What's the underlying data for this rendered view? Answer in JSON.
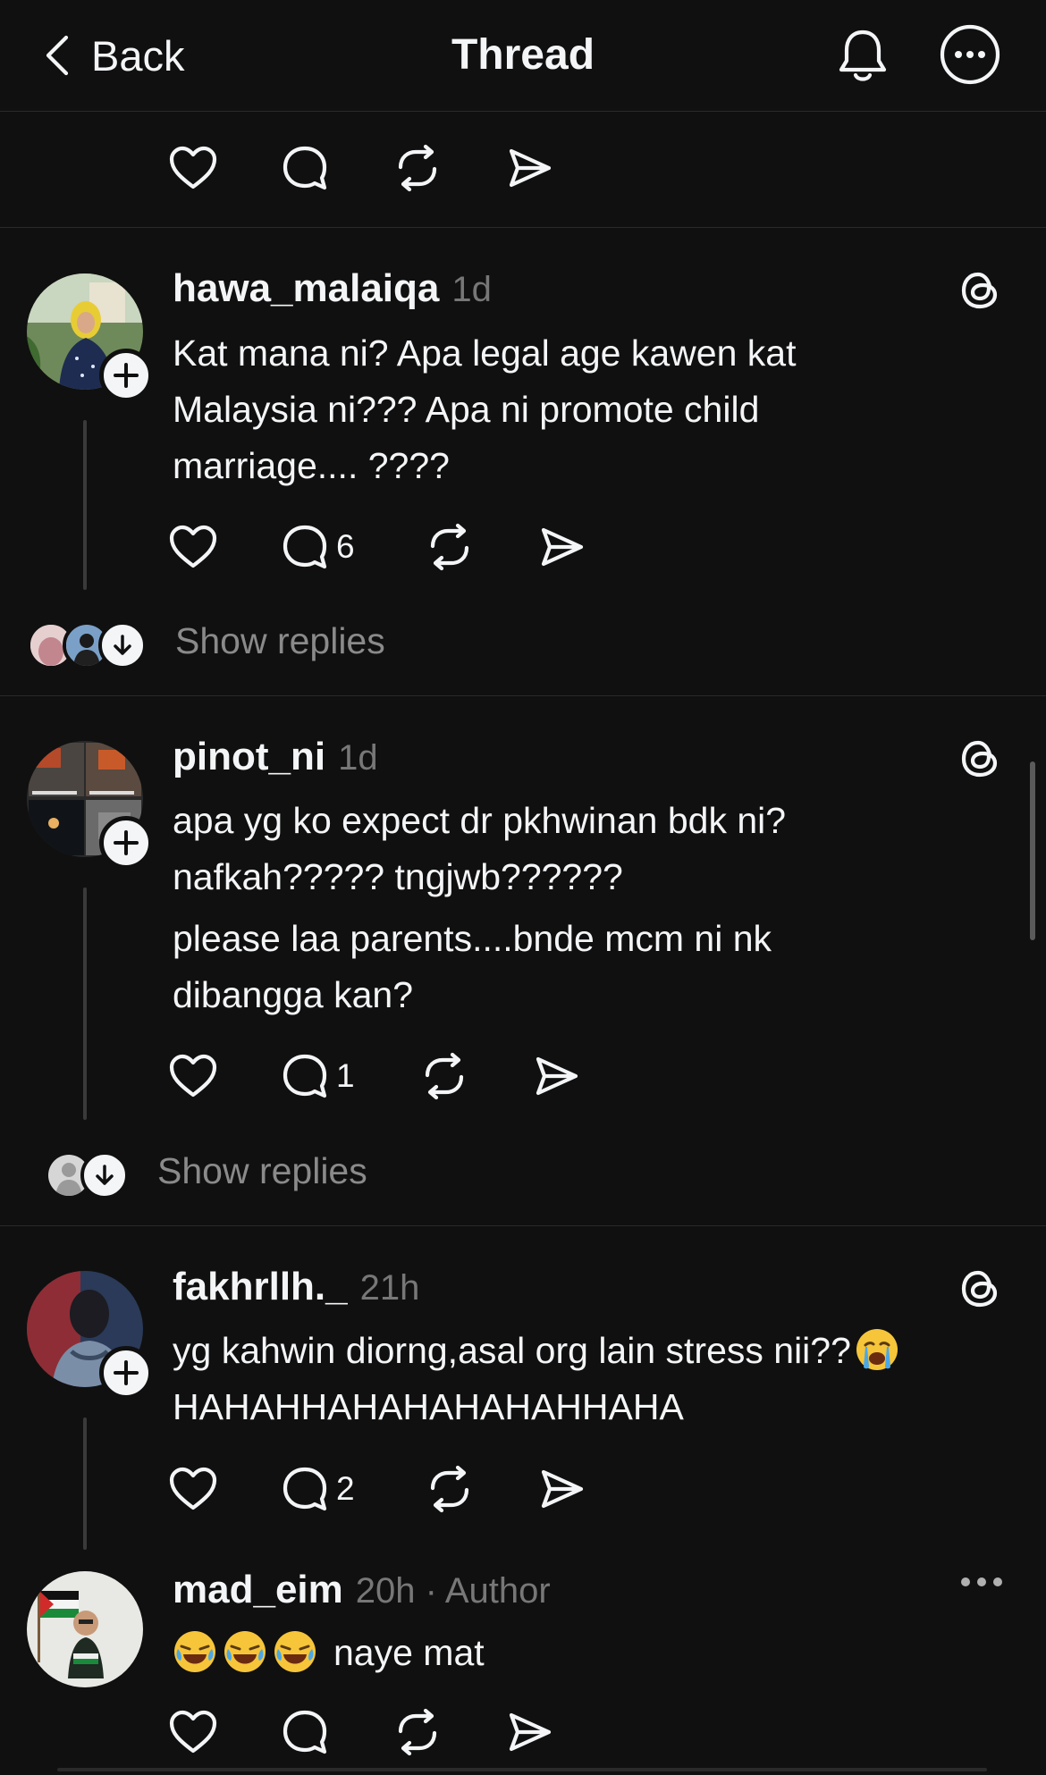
{
  "header": {
    "back_label": "Back",
    "title": "Thread"
  },
  "posts": [
    {
      "username": "hawa_malaiqa",
      "time": "1d",
      "text": "Kat mana ni? Apa legal age kawen kat\nMalaysia ni??? Apa ni promote child\nmarriage.... ????",
      "reply_count": "6",
      "show_replies": "Show replies"
    },
    {
      "username": "pinot_ni",
      "time": "1d",
      "text_p1": "apa yg ko expect dr pkhwinan bdk ni?\nnafkah????? tngjwb??????",
      "text_p2": "please laa parents....bnde mcm ni nk\ndibangga kan?",
      "reply_count": "1",
      "show_replies": "Show replies"
    },
    {
      "username": "fakhrllh._",
      "time": "21h",
      "text": "yg kahwin diorng,asal org lain stress nii??",
      "text_line2": "HAHAHHAHAHAHAHAHHAHA",
      "reply_count": "2"
    },
    {
      "username": "mad_eim",
      "time": "20h · Author",
      "text": "naye mat"
    }
  ]
}
